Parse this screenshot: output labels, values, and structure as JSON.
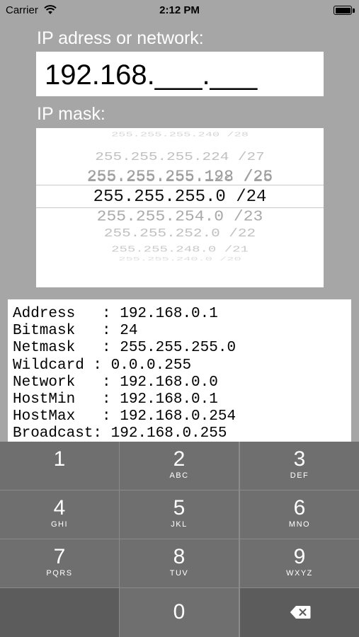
{
  "status_bar": {
    "carrier": "Carrier",
    "time": "2:12 PM"
  },
  "ip_input": {
    "label": "IP adress or network:",
    "value": "192.168.___.___"
  },
  "mask_picker": {
    "label": "IP mask:",
    "options_above": [
      "255.255.255.240 /28",
      "255.255.255.224 /27",
      "255.255.255.192 /26",
      "255.255.255.128 /25"
    ],
    "selected": "255.255.255.0 /24",
    "options_below": [
      "255.255.254.0 /23",
      "255.255.252.0 /22",
      "255.255.248.0 /21",
      "255.255.240.0 /20"
    ]
  },
  "results": {
    "lines": [
      "Address   : 192.168.0.1",
      "Bitmask   : 24",
      "Netmask   : 255.255.255.0",
      "Wildcard : 0.0.0.255",
      "Network   : 192.168.0.0",
      "HostMin   : 192.168.0.1",
      "HostMax   : 192.168.0.254",
      "Broadcast: 192.168.0.255"
    ]
  },
  "keypad": {
    "keys": [
      {
        "num": "1",
        "letters": ""
      },
      {
        "num": "2",
        "letters": "ABC"
      },
      {
        "num": "3",
        "letters": "DEF"
      },
      {
        "num": "4",
        "letters": "GHI"
      },
      {
        "num": "5",
        "letters": "JKL"
      },
      {
        "num": "6",
        "letters": "MNO"
      },
      {
        "num": "7",
        "letters": "PQRS"
      },
      {
        "num": "8",
        "letters": "TUV"
      },
      {
        "num": "9",
        "letters": "WXYZ"
      },
      {
        "num": "0",
        "letters": ""
      }
    ],
    "delete_icon": "backspace-icon"
  }
}
